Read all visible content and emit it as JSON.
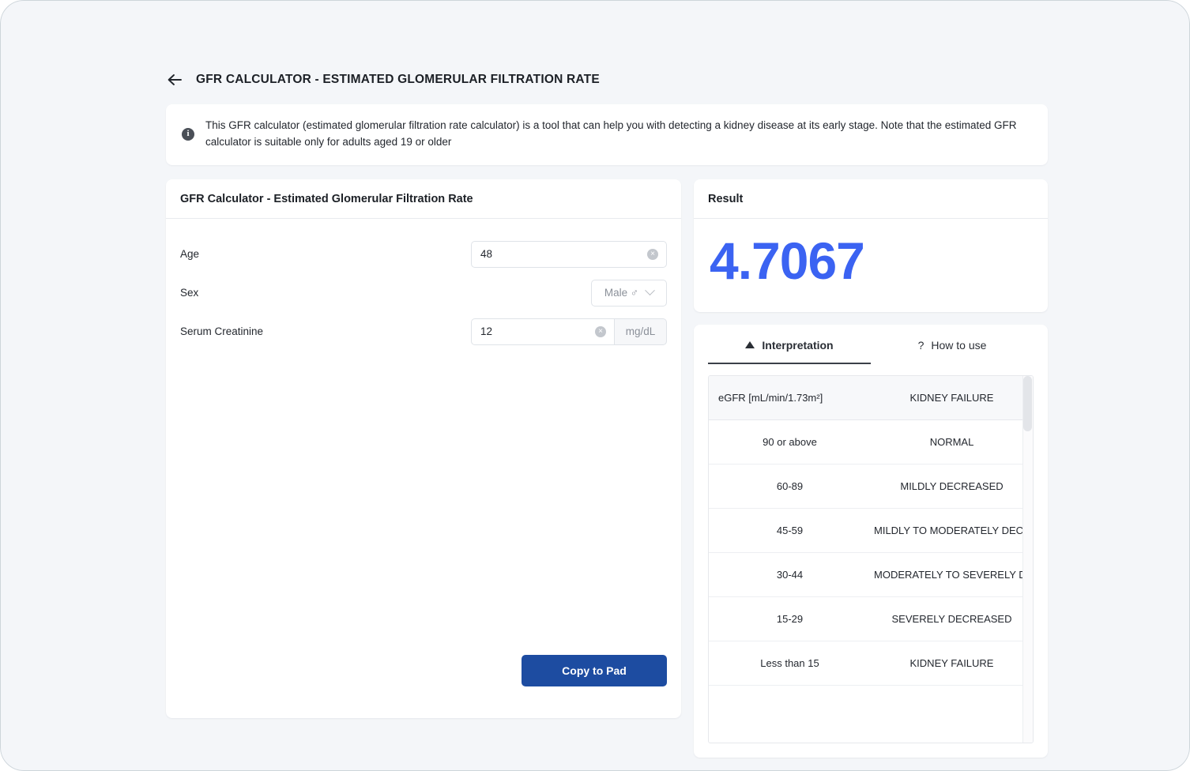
{
  "header": {
    "back_icon": "arrow-left-icon",
    "title": "GFR CALCULATOR - ESTIMATED GLOMERULAR FILTRATION RATE"
  },
  "banner": {
    "icon": "info-icon",
    "icon_glyph": "i",
    "text": "This GFR calculator (estimated glomerular filtration rate calculator) is a tool that can help you with detecting a kidney disease at its early stage. Note that the estimated GFR calculator is suitable only for adults aged 19 or older"
  },
  "form": {
    "title": "GFR Calculator - Estimated Glomerular Filtration Rate",
    "fields": [
      {
        "label": "Age",
        "value": "48",
        "placeholder": "",
        "clear_icon": "clear-icon",
        "unit": ""
      },
      {
        "label": "Sex",
        "value": "Male ♂",
        "placeholder": "",
        "clear_icon": "",
        "unit": ""
      },
      {
        "label": "Serum Creatinine",
        "value": "12",
        "placeholder": "",
        "clear_icon": "clear-icon",
        "unit": "mg/dL"
      }
    ],
    "clear_glyph": "×",
    "copy_button": "Copy to Pad"
  },
  "result": {
    "title": "Result",
    "value": "4.7067",
    "color": "#3b63f2"
  },
  "tabs": [
    {
      "label": "Interpretation",
      "icon": "triangle-up-icon",
      "active": true
    },
    {
      "label": "How to use",
      "icon": "question-mark-icon",
      "active": false
    }
  ],
  "interpretation_table": {
    "columns": [
      "eGFR [mL/min/1.73m²]",
      "KIDNEY FAILURE"
    ],
    "rows": [
      [
        "90 or above",
        "NORMAL"
      ],
      [
        "60-89",
        "MILDLY DECREASED"
      ],
      [
        "45-59",
        "MILDLY TO MODERATELY DECREASED"
      ],
      [
        "30-44",
        "MODERATELY TO SEVERELY DECREASED"
      ],
      [
        "15-29",
        "SEVERELY DECREASED"
      ],
      [
        "Less than 15",
        "KIDNEY FAILURE"
      ],
      [
        "",
        ""
      ]
    ]
  }
}
